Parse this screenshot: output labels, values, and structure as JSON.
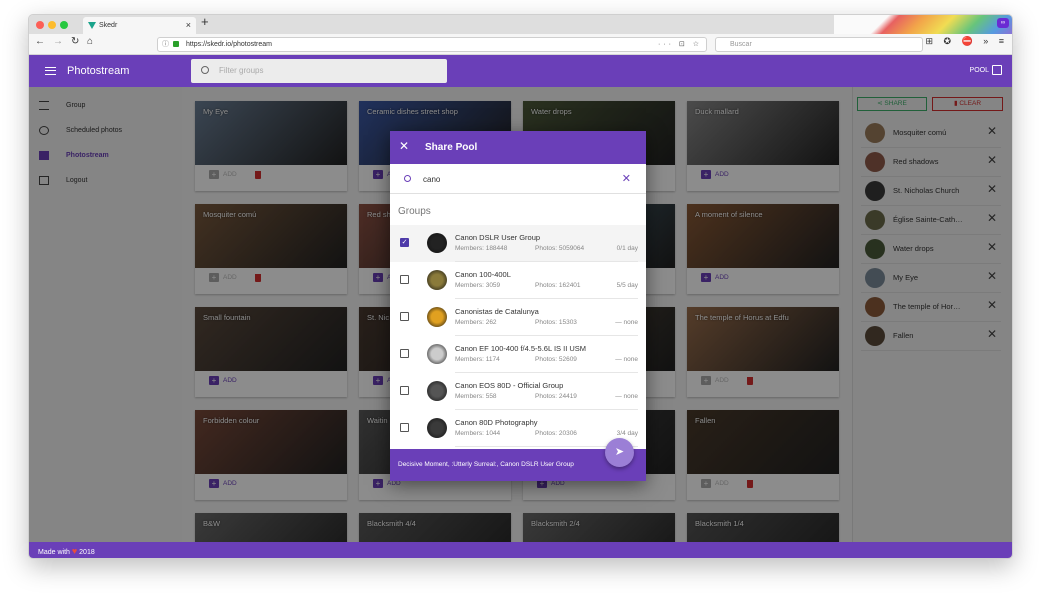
{
  "browser": {
    "tab_title": "Skedr",
    "tab_close": "×",
    "new_tab": "+",
    "url": "https://skedr.io/photostream",
    "search_placeholder": "Buscar",
    "url_icons": "··· ⊡ ☆",
    "tools": "⊞ ✪ ⛔ » ≡",
    "private_badge": "∞"
  },
  "appbar": {
    "title": "Photostream",
    "filter_placeholder": "Filter groups",
    "pool_label": "POOL"
  },
  "sidebar": {
    "items": [
      {
        "label": "Group"
      },
      {
        "label": "Scheduled photos"
      },
      {
        "label": "Photostream"
      },
      {
        "label": "Logout"
      }
    ]
  },
  "cards": [
    {
      "title": "My Eye",
      "action": "ADD",
      "added": false,
      "color": "#6b7f96"
    },
    {
      "title": "Ceramic dishes street shop",
      "action": "ADD",
      "added": true,
      "color": "#3c5aa8"
    },
    {
      "title": "Water drops",
      "action": "ADD",
      "added": true,
      "color": "#4d5a3a"
    },
    {
      "title": "Duck mallard",
      "action": "ADD",
      "added": true,
      "color": "#8a8a8a"
    },
    {
      "title": "Mosquiter comú",
      "action": "ADD",
      "added": false,
      "color": "#7a5a3e"
    },
    {
      "title": "Red sh",
      "action": "ADD",
      "added": true,
      "color": "#8e5244"
    },
    {
      "title": "",
      "action": "ADD",
      "added": true,
      "color": "#4f6e7e"
    },
    {
      "title": "A moment of silence",
      "action": "ADD",
      "added": true,
      "color": "#8a5a36"
    },
    {
      "title": "Small fountain",
      "action": "ADD",
      "added": true,
      "color": "#5b4a3d"
    },
    {
      "title": "St. Nic",
      "action": "ADD",
      "added": true,
      "color": "#4a3a30"
    },
    {
      "title": "",
      "action": "ADD",
      "added": true,
      "color": "#5a5040"
    },
    {
      "title": "The temple of Horus at Edfu",
      "action": "ADD",
      "added": false,
      "color": "#9a6e4c"
    },
    {
      "title": "Forbidden colour",
      "action": "ADD",
      "added": true,
      "color": "#7a4a3a"
    },
    {
      "title": "Waitin",
      "action": "ADD",
      "added": true,
      "color": "#5a5a5a"
    },
    {
      "title": "",
      "action": "ADD",
      "added": true,
      "color": "#4a4a4a"
    },
    {
      "title": "Fallen",
      "action": "ADD",
      "added": false,
      "color": "#4a3a2a"
    },
    {
      "title": "B&W",
      "action": "",
      "added": false,
      "color": "#6a6a6a"
    },
    {
      "title": "Blacksmith 4/4",
      "action": "",
      "added": false,
      "color": "#5a5a5a"
    },
    {
      "title": "Blacksmith 2/4",
      "action": "",
      "added": false,
      "color": "#6a6a6a"
    },
    {
      "title": "Blacksmith 1/4",
      "action": "",
      "added": false,
      "color": "#555555"
    }
  ],
  "pool_panel": {
    "share_label": "SHARE",
    "clear_label": "CLEAR",
    "items": [
      {
        "name": "Mosquiter comú",
        "color": "#9a7a5a"
      },
      {
        "name": "Red shadows",
        "color": "#8e5a4a"
      },
      {
        "name": "St. Nicholas Church",
        "color": "#3a3a3a"
      },
      {
        "name": "Église Sainte-Cath…",
        "color": "#6a6a4a"
      },
      {
        "name": "Water drops",
        "color": "#4a5a3a"
      },
      {
        "name": "My Eye",
        "color": "#7a8a9a"
      },
      {
        "name": "The temple of Hor…",
        "color": "#8a5a3a"
      },
      {
        "name": "Fallen",
        "color": "#5a4a3a"
      }
    ],
    "remove_icon": "✕"
  },
  "modal": {
    "title": "Share Pool",
    "close_icon": "✕",
    "query": "cano",
    "clear_icon": "✕",
    "section": "Groups",
    "groups": [
      {
        "name": "Canon DSLR User Group",
        "members": "Members: 188448",
        "photos": "Photos: 5059064",
        "throttle": "0/1 day",
        "checked": true,
        "color": "#222"
      },
      {
        "name": "Canon 100-400L",
        "members": "Members: 3059",
        "photos": "Photos: 162401",
        "throttle": "5/5 day",
        "checked": false,
        "color": "#8a7a3a"
      },
      {
        "name": "Canonistas de Catalunya",
        "members": "Members: 262",
        "photos": "Photos: 15303",
        "throttle": "— none",
        "checked": false,
        "color": "#e0a020"
      },
      {
        "name": "Canon EF 100-400 f/4.5-5.6L IS II USM",
        "members": "Members: 1174",
        "photos": "Photos: 52609",
        "throttle": "— none",
        "checked": false,
        "color": "#ccc"
      },
      {
        "name": "Canon EOS 80D - Official Group",
        "members": "Members: 558",
        "photos": "Photos: 24419",
        "throttle": "— none",
        "checked": false,
        "color": "#555"
      },
      {
        "name": "Canon 80D Photography",
        "members": "Members: 1044",
        "photos": "Photos: 20306",
        "throttle": "3/4 day",
        "checked": false,
        "color": "#3a3a3a"
      }
    ],
    "selected_summary": "Decisive Moment, :Utterly Surreal:, Canon DSLR User Group",
    "send_icon": "➤"
  },
  "footer": {
    "made_with": "Made with",
    "heart": "♥",
    "year": "2018"
  }
}
